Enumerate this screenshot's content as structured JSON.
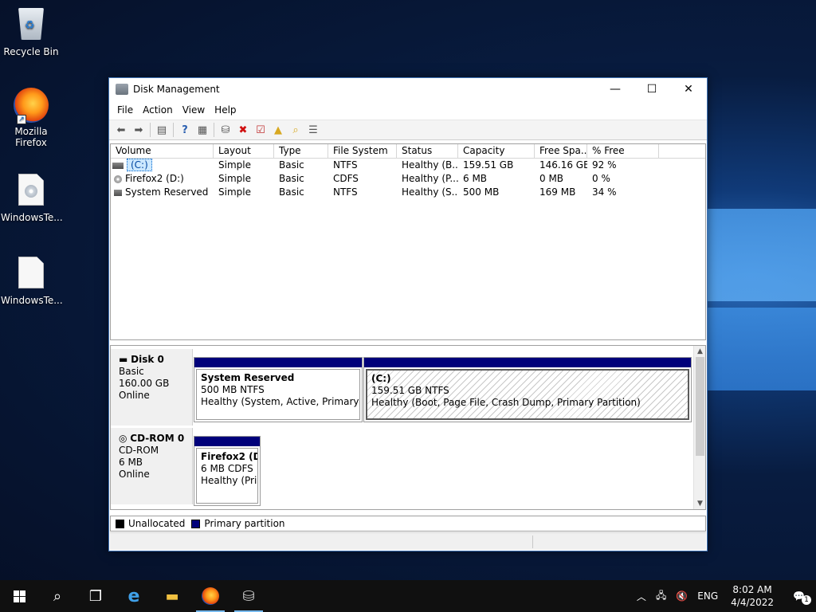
{
  "desktop": {
    "icons": [
      {
        "label": "Recycle Bin"
      },
      {
        "label": "Mozilla Firefox"
      },
      {
        "label": "WindowsTe..."
      },
      {
        "label": "WindowsTe..."
      }
    ]
  },
  "window": {
    "title": "Disk Management",
    "menu": [
      "File",
      "Action",
      "View",
      "Help"
    ],
    "controls": {
      "minimize": "—",
      "maximize": "☐",
      "close": "✕"
    }
  },
  "toolbar": {
    "icons": [
      "back-arrow-icon",
      "forward-arrow-icon",
      "console-tree-icon",
      "help-icon",
      "properties-icon",
      "connect-disk-icon",
      "delete-icon",
      "check-icon",
      "folder-up-icon",
      "search-folder-icon",
      "list-view-icon"
    ]
  },
  "volumes": {
    "columns": [
      "Volume",
      "Layout",
      "Type",
      "File System",
      "Status",
      "Capacity",
      "Free Spa...",
      "% Free"
    ],
    "rows": [
      {
        "volume": "(C:)",
        "layout": "Simple",
        "type": "Basic",
        "fs": "NTFS",
        "status": "Healthy (B...",
        "capacity": "159.51 GB",
        "free": "146.16 GB",
        "pct": "92 %"
      },
      {
        "volume": "Firefox2 (D:)",
        "layout": "Simple",
        "type": "Basic",
        "fs": "CDFS",
        "status": "Healthy (P...",
        "capacity": "6 MB",
        "free": "0 MB",
        "pct": "0 %"
      },
      {
        "volume": "System Reserved",
        "layout": "Simple",
        "type": "Basic",
        "fs": "NTFS",
        "status": "Healthy (S...",
        "capacity": "500 MB",
        "free": "169 MB",
        "pct": "34 %"
      }
    ]
  },
  "disks": [
    {
      "name": "Disk 0",
      "kind": "Basic",
      "size": "160.00 GB",
      "state": "Online",
      "partitions": [
        {
          "name": "System Reserved",
          "size": "500 MB NTFS",
          "status": "Healthy (System, Active, Primary Part"
        },
        {
          "name": "(C:)",
          "size": "159.51 GB NTFS",
          "status": "Healthy (Boot, Page File, Crash Dump, Primary Partition)"
        }
      ]
    },
    {
      "name": "CD-ROM 0",
      "kind": "CD-ROM",
      "size": "6 MB",
      "state": "Online",
      "partitions": [
        {
          "name": "Firefox2  (D",
          "size": "6 MB CDFS",
          "status": "Healthy (Prir"
        }
      ]
    }
  ],
  "legend": {
    "unallocated": "Unallocated",
    "primary": "Primary partition",
    "unallocated_color": "#000000",
    "primary_color": "#00007a"
  },
  "taskbar": {
    "tray_lang": "ENG",
    "time": "8:02 AM",
    "date": "4/4/2022",
    "notification_count": "1"
  }
}
